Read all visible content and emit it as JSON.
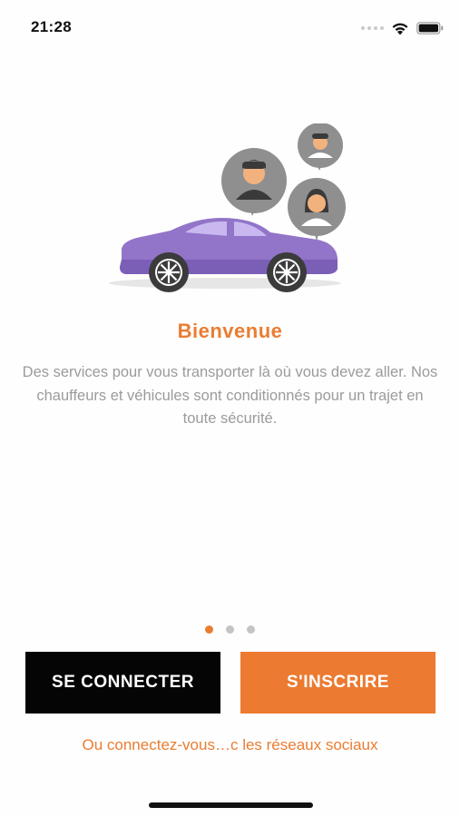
{
  "status_bar": {
    "time": "21:28",
    "icons": [
      "signal-dots-icon",
      "wifi-icon",
      "battery-icon"
    ]
  },
  "onboarding": {
    "illustration": "car-with-passengers-illustration",
    "title": "Bienvenue",
    "description": "Des services pour vous transporter là où vous devez aller. Nos chauffeurs et véhicules sont conditionnés pour un trajet en toute sécurité.",
    "page_indicator": {
      "current": 1,
      "total": 3
    }
  },
  "actions": {
    "login_label": "SE CONNECTER",
    "signup_label": "S'INSCRIRE",
    "social_link": "Ou connectez-vous…c les réseaux sociaux"
  },
  "colors": {
    "accent": "#ea7d32",
    "login_button": "#050505",
    "signup_button": "#ec7a31",
    "description_text": "#9b9b9b",
    "car": "#9274c9",
    "dot_active": "#ea7d32",
    "dot_inactive": "#c4c4c4"
  }
}
